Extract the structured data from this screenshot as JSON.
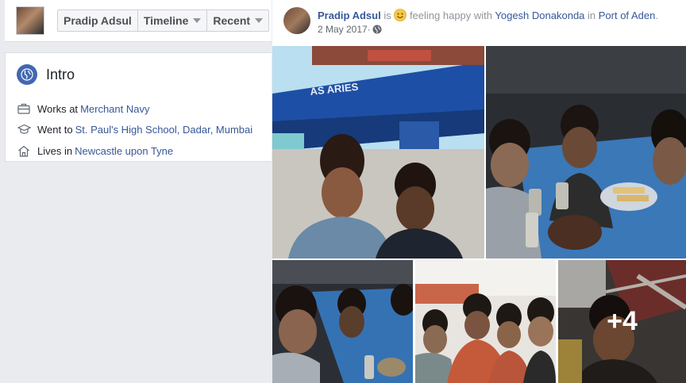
{
  "topbar": {
    "name": "Pradip Adsul",
    "timeline": "Timeline",
    "recent": "Recent"
  },
  "intro": {
    "title": "Intro",
    "works_prefix": "Works at ",
    "works_value": "Merchant Navy",
    "went_prefix": "Went to ",
    "went_value": "St. Paul's High School, Dadar, Mumbai",
    "lives_prefix": "Lives in ",
    "lives_value": "Newcastle upon Tyne"
  },
  "post": {
    "author": "Pradip Adsul",
    "is": " is ",
    "feeling": " feeling happy with ",
    "tagged": "Yogesh Donakonda",
    "in": " in ",
    "place": "Port of Aden",
    "end": ".",
    "date": "2 May 2017",
    "sep": " · ",
    "ship_name": "AS ARIES",
    "more_photos": "+4"
  },
  "colors": {
    "link": "#365899",
    "accent": "#4267b2",
    "page_bg": "#e9ebee"
  }
}
